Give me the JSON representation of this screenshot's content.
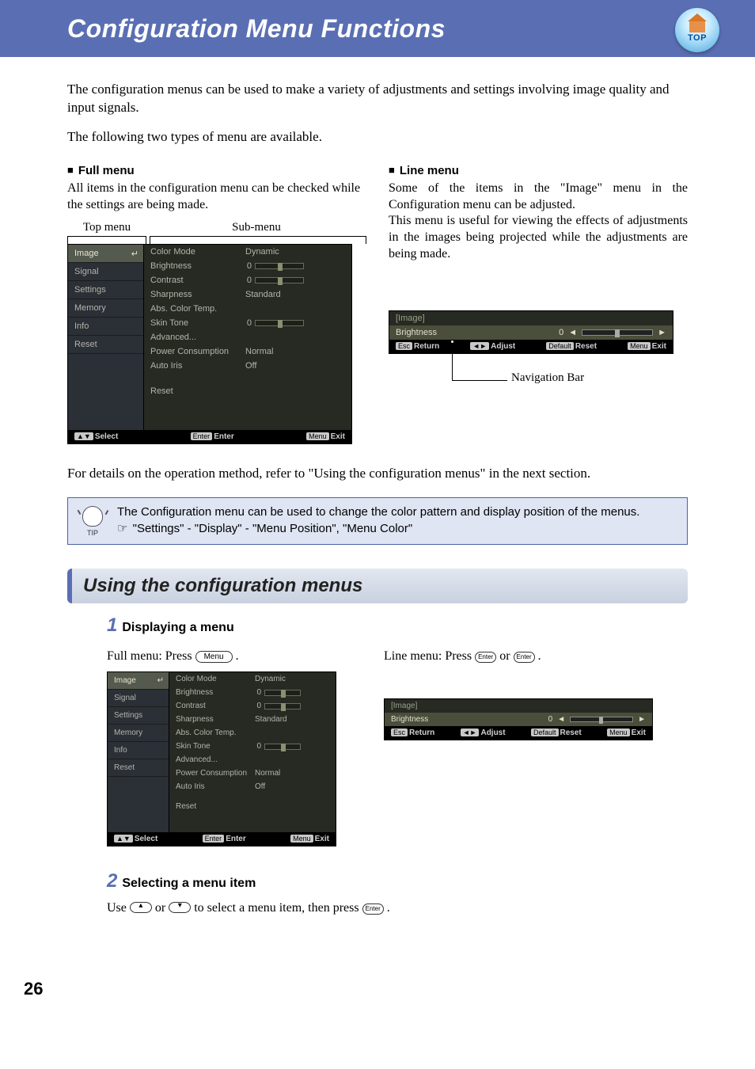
{
  "page_number": "26",
  "titlebar": {
    "title": "Configuration Menu Functions",
    "top_label": "TOP"
  },
  "intro": {
    "p1": "The configuration menus can be used to make a variety of adjustments and settings involving image quality and input signals.",
    "p2": "The following two types of menu are available."
  },
  "full_menu": {
    "heading": "Full menu",
    "desc": "All items in the configuration menu can be checked while the settings are being made.",
    "label_top": "Top menu",
    "label_sub": "Sub-menu",
    "left_items": [
      "Image",
      "Signal",
      "Settings",
      "Memory",
      "Info",
      "Reset"
    ],
    "right_items": [
      {
        "label": "Color Mode",
        "value": "Dynamic"
      },
      {
        "label": "Brightness",
        "value": "0",
        "slider": true
      },
      {
        "label": "Contrast",
        "value": "0",
        "slider": true
      },
      {
        "label": "Sharpness",
        "value": "Standard"
      },
      {
        "label": "Abs. Color Temp.",
        "value": ""
      },
      {
        "label": "Skin Tone",
        "value": "0",
        "slider": true
      },
      {
        "label": "Advanced...",
        "value": ""
      },
      {
        "label": "Power Consumption",
        "value": "Normal"
      },
      {
        "label": "Auto Iris",
        "value": "Off"
      },
      {
        "label": "",
        "value": ""
      },
      {
        "label": "Reset",
        "value": ""
      }
    ],
    "footer": {
      "select": "Select",
      "enter": "Enter",
      "exit": "Exit",
      "select_key": "▲▼",
      "enter_key": "Enter",
      "exit_key": "Menu"
    }
  },
  "line_menu": {
    "heading": "Line menu",
    "desc1": "Some of the items in the \"Image\" menu in the Configuration menu can be adjusted.",
    "desc2": "This menu is useful for viewing the effects of adjustments in the images being projected while the adjustments are being made.",
    "header": "[Image]",
    "row_label": "Brightness",
    "row_value": "0",
    "footer": {
      "return": "Return",
      "adjust": "Adjust",
      "reset": "Reset",
      "exit": "Exit",
      "return_key": "Esc",
      "adjust_key": "◄►",
      "reset_key": "Default",
      "exit_key": "Menu"
    },
    "nav_caption": "Navigation Bar"
  },
  "details": "For details on the operation method, refer to \"Using the configuration menus\" in the next section.",
  "tip": {
    "label": "TIP",
    "line1": "The Configuration menu can be used to change the color pattern and display position of the menus.",
    "line2": " \"Settings\" - \"Display\" - \"Menu Position\", \"Menu Color\""
  },
  "section2": {
    "title": "Using the configuration menus"
  },
  "step1": {
    "num": "1",
    "title": "Displaying a menu",
    "full_label": "Full menu: Press ",
    "full_btn": "Menu",
    "line_label": "Line menu: Press ",
    "or": " or ",
    "enter_btn": "Enter",
    "period": " ."
  },
  "step2": {
    "num": "2",
    "title": "Selecting a menu item",
    "text_a": "Use ",
    "text_b": " or ",
    "text_c": " to select a menu item, then press ",
    "enter_btn": "Enter",
    "period": " ."
  }
}
